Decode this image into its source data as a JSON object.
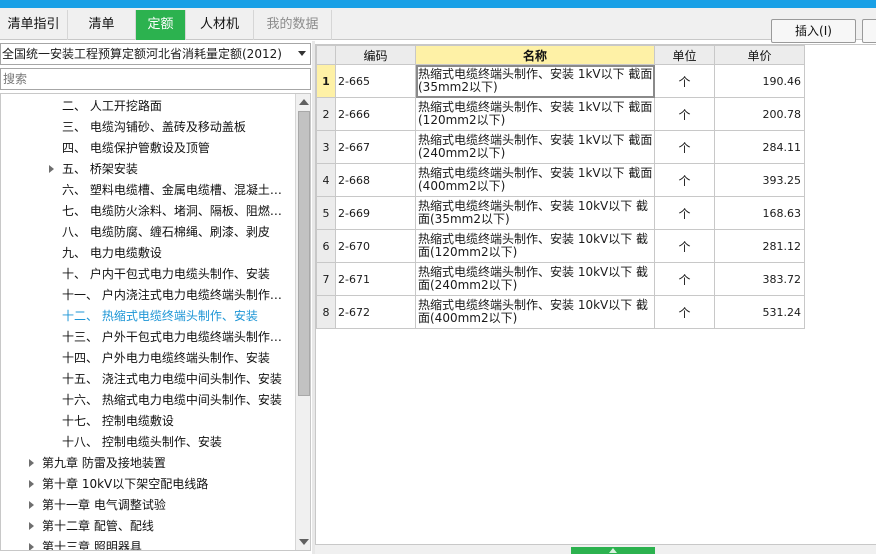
{
  "tabs": [
    {
      "label": "清单指引",
      "state": "normal"
    },
    {
      "label": "清单",
      "state": "normal"
    },
    {
      "label": "定额",
      "state": "active"
    },
    {
      "label": "人材机",
      "state": "normal"
    },
    {
      "label": "我的数据",
      "state": "disabled"
    }
  ],
  "toolbar": {
    "insert_label": "插入(I)"
  },
  "library_select": {
    "value": "全国统一安装工程预算定额河北省消耗量定额(2012)"
  },
  "search": {
    "placeholder": "搜索"
  },
  "tree": {
    "items": [
      {
        "label": "二、 人工开挖路面",
        "level": 2,
        "expandable": false,
        "selected": false
      },
      {
        "label": "三、 电缆沟铺砂、盖砖及移动盖板",
        "level": 2,
        "expandable": false,
        "selected": false
      },
      {
        "label": "四、 电缆保护管敷设及顶管",
        "level": 2,
        "expandable": false,
        "selected": false
      },
      {
        "label": "五、 桥架安装",
        "level": 2,
        "expandable": true,
        "selected": false
      },
      {
        "label": "六、 塑料电缆槽、金属电缆槽、混凝土…",
        "level": 2,
        "expandable": false,
        "selected": false
      },
      {
        "label": "七、 电缆防火涂料、堵洞、隔板、阻燃…",
        "level": 2,
        "expandable": false,
        "selected": false
      },
      {
        "label": "八、 电缆防腐、缠石棉绳、刷漆、剥皮",
        "level": 2,
        "expandable": false,
        "selected": false
      },
      {
        "label": "九、 电力电缆敷设",
        "level": 2,
        "expandable": false,
        "selected": false
      },
      {
        "label": "十、 户内干包式电力电缆头制作、安装",
        "level": 2,
        "expandable": false,
        "selected": false
      },
      {
        "label": "十一、 户内浇注式电力电缆终端头制作…",
        "level": 2,
        "expandable": false,
        "selected": false
      },
      {
        "label": "十二、 热缩式电缆终端头制作、安装",
        "level": 2,
        "expandable": false,
        "selected": true
      },
      {
        "label": "十三、 户外干包式电力电缆终端头制作…",
        "level": 2,
        "expandable": false,
        "selected": false
      },
      {
        "label": "十四、 户外电力电缆终端头制作、安装",
        "level": 2,
        "expandable": false,
        "selected": false
      },
      {
        "label": "十五、 浇注式电力电缆中间头制作、安装",
        "level": 2,
        "expandable": false,
        "selected": false
      },
      {
        "label": "十六、 热缩式电力电缆中间头制作、安装",
        "level": 2,
        "expandable": false,
        "selected": false
      },
      {
        "label": "十七、 控制电缆敷设",
        "level": 2,
        "expandable": false,
        "selected": false
      },
      {
        "label": "十八、 控制电缆头制作、安装",
        "level": 2,
        "expandable": false,
        "selected": false
      },
      {
        "label": "第九章 防雷及接地装置",
        "level": 1,
        "expandable": true,
        "selected": false
      },
      {
        "label": "第十章 10kV以下架空配电线路",
        "level": 1,
        "expandable": true,
        "selected": false
      },
      {
        "label": "第十一章 电气调整试验",
        "level": 1,
        "expandable": true,
        "selected": false
      },
      {
        "label": "第十二章 配管、配线",
        "level": 1,
        "expandable": true,
        "selected": false
      },
      {
        "label": "第十三章 照明器具",
        "level": 1,
        "expandable": true,
        "selected": false
      }
    ]
  },
  "grid": {
    "columns": [
      "编码",
      "名称",
      "单位",
      "单价"
    ],
    "rows": [
      {
        "num": "1",
        "code": "2-665",
        "name_line1": "热缩式电缆终端头制作、安装 1kV以下 截面",
        "name_line2": "(35mm2以下)",
        "unit": "个",
        "price": "190.46"
      },
      {
        "num": "2",
        "code": "2-666",
        "name_line1": "热缩式电缆终端头制作、安装 1kV以下 截面",
        "name_line2": "(120mm2以下)",
        "unit": "个",
        "price": "200.78"
      },
      {
        "num": "3",
        "code": "2-667",
        "name_line1": "热缩式电缆终端头制作、安装 1kV以下 截面",
        "name_line2": "(240mm2以下)",
        "unit": "个",
        "price": "284.11"
      },
      {
        "num": "4",
        "code": "2-668",
        "name_line1": "热缩式电缆终端头制作、安装 1kV以下 截面",
        "name_line2": "(400mm2以下)",
        "unit": "个",
        "price": "393.25"
      },
      {
        "num": "5",
        "code": "2-669",
        "name_line1": "热缩式电缆终端头制作、安装 10kV以下 截",
        "name_line2": "面(35mm2以下)",
        "unit": "个",
        "price": "168.63"
      },
      {
        "num": "6",
        "code": "2-670",
        "name_line1": "热缩式电缆终端头制作、安装 10kV以下 截",
        "name_line2": "面(120mm2以下)",
        "unit": "个",
        "price": "281.12"
      },
      {
        "num": "7",
        "code": "2-671",
        "name_line1": "热缩式电缆终端头制作、安装 10kV以下 截",
        "name_line2": "面(240mm2以下)",
        "unit": "个",
        "price": "383.72"
      },
      {
        "num": "8",
        "code": "2-672",
        "name_line1": "热缩式电缆终端头制作、安装 10kV以下 截",
        "name_line2": "面(400mm2以下)",
        "unit": "个",
        "price": "531.24"
      }
    ]
  },
  "colors": {
    "accent_green": "#2cb24f",
    "selected_blue": "#1e96d6",
    "title_blue": "#19a0e6",
    "highlight_yellow": "#fef1a6"
  }
}
